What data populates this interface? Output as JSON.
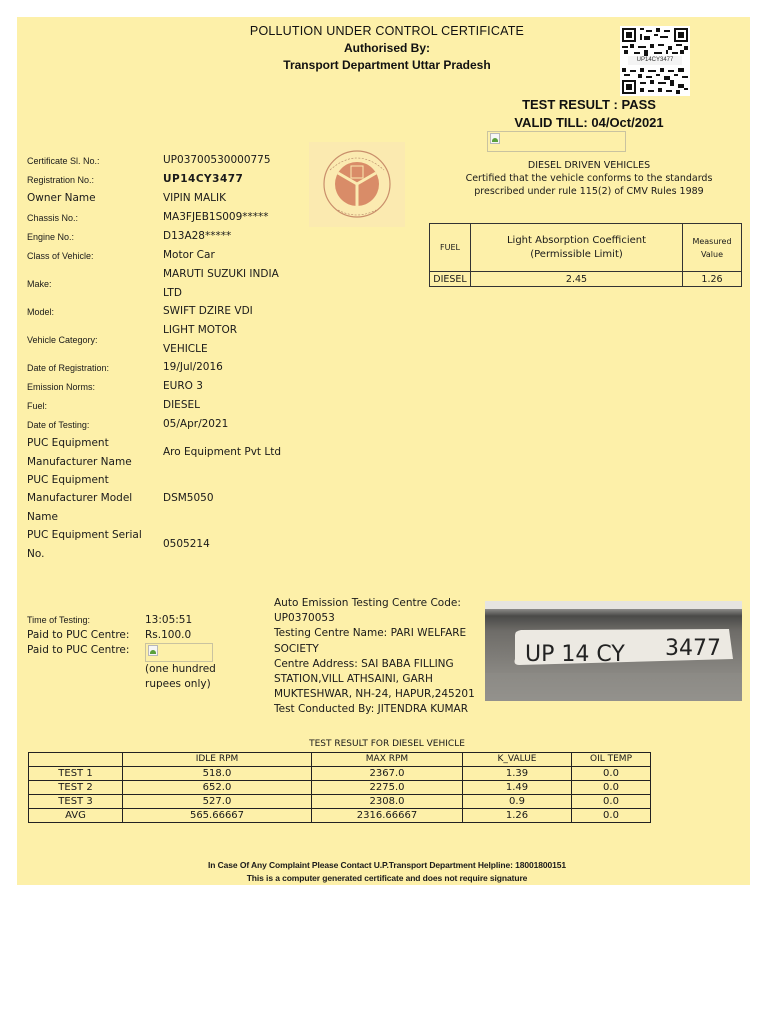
{
  "header": {
    "title": "POLLUTION UNDER CONTROL CERTIFICATE",
    "authorised_by": "Authorised By:",
    "authority": "Transport Department Uttar Pradesh",
    "qr_label": "UP14CY3477"
  },
  "result": {
    "test_result": "TEST RESULT : PASS",
    "valid_till": "VALID TILL: 04/Oct/2021",
    "category_heading": "DIESEL DRIVEN VEHICLES",
    "certification_line1": "Certified that the vehicle conforms to the standards",
    "certification_line2": "prescribed under rule 115(2) of CMV Rules 1989"
  },
  "limit_table": {
    "headers": {
      "fuel": "FUEL",
      "coefficient_line1": "Light Absorption Coefficient",
      "coefficient_line2": "(Permissible Limit)",
      "measured_line1": "Measured",
      "measured_line2": "Value"
    },
    "row": {
      "fuel": "DIESEL",
      "limit": "2.45",
      "measured": "1.26"
    }
  },
  "details": [
    {
      "label": "Certificate Sl. No.:",
      "value": "UP03700530000775"
    },
    {
      "label": "Registration No.:",
      "value": "UP14CY3477"
    },
    {
      "label": "Owner Name",
      "value": "VIPIN MALIK"
    },
    {
      "label": "Chassis No.:",
      "value": "MA3FJEB1S009*****"
    },
    {
      "label": "Engine No.:",
      "value": "D13A28*****"
    },
    {
      "label": "Class of Vehicle:",
      "value": "Motor Car"
    },
    {
      "label": "Make:",
      "value": "MARUTI SUZUKI INDIA LTD"
    },
    {
      "label": "Model:",
      "value": "SWIFT DZIRE VDI"
    },
    {
      "label": "Vehicle Category:",
      "value": "LIGHT MOTOR VEHICLE"
    },
    {
      "label": "Date of Registration:",
      "value": "19/Jul/2016"
    },
    {
      "label": "Emission Norms:",
      "value": "EURO 3"
    },
    {
      "label": "Fuel:",
      "value": "DIESEL"
    },
    {
      "label": "Date of Testing:",
      "value": "05/Apr/2021"
    },
    {
      "label": "PUC Equipment Manufacturer Name",
      "value": "Aro Equipment Pvt Ltd"
    },
    {
      "label": "PUC Equipment Manufacturer Model Name",
      "value": "DSM5050"
    },
    {
      "label": "PUC Equipment Serial No.",
      "value": "0505214"
    }
  ],
  "payment": {
    "time_label": "Time of Testing:",
    "time_value": "13:05:51",
    "paid_label": "Paid to PUC Centre:",
    "paid_value": "Rs.100.0",
    "paid_label2": "Paid to PUC Centre:",
    "amount_words": "(one hundred rupees only)"
  },
  "centre": {
    "code_label": "Auto Emission Testing Centre Code:",
    "code": "UP0370053",
    "name_label": "Testing Centre Name:",
    "name": "PARI WELFARE SOCIETY",
    "address_label": "Centre Address:",
    "address": "SAI BABA FILLING STATION,VILL ATHSAINI, GARH MUKTESHWAR, NH-24, HAPUR,245201",
    "conducted_label": "Test Conducted By:",
    "conducted_by": "JITENDRA KUMAR"
  },
  "plate_photo": {
    "text_left": "UP 14 CY",
    "text_right": "3477"
  },
  "diesel_results": {
    "title": "TEST RESULT FOR DIESEL VEHICLE",
    "columns": [
      "",
      "IDLE RPM",
      "MAX RPM",
      "K_VALUE",
      "OIL TEMP"
    ],
    "rows": [
      [
        "TEST 1",
        "518.0",
        "2367.0",
        "1.39",
        "0.0"
      ],
      [
        "TEST 2",
        "652.0",
        "2275.0",
        "1.49",
        "0.0"
      ],
      [
        "TEST 3",
        "527.0",
        "2308.0",
        "0.9",
        "0.0"
      ],
      [
        "AVG",
        "565.66667",
        "2316.66667",
        "1.26",
        "0.0"
      ]
    ]
  },
  "footer": {
    "helpline": "In Case Of Any Complaint Please Contact U.P.Transport Department Helpline: 18001800151",
    "note": "This is a computer generated certificate and does not require signature"
  }
}
